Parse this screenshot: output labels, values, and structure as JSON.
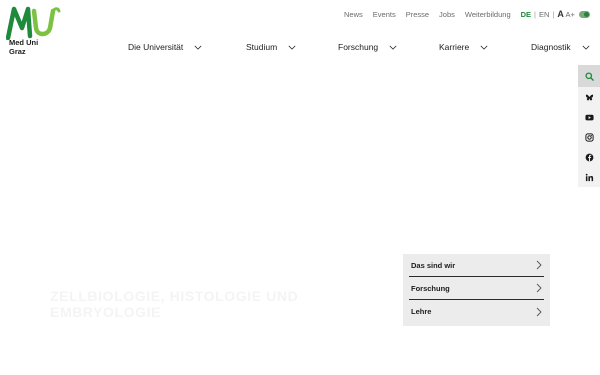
{
  "brand": {
    "logo_text_line1": "Med Uni",
    "logo_text_line2": "Graz",
    "green": "#1e8a3c",
    "light_green": "#7cc242"
  },
  "meta_nav": {
    "links": [
      "News",
      "Events",
      "Presse",
      "Jobs",
      "Weiterbildung"
    ],
    "lang_active": "DE",
    "lang_sep": "|",
    "lang_other": "EN",
    "fontsize_sep": "|",
    "fontsize_small": "A",
    "fontsize_big": "A+"
  },
  "main_nav": {
    "items": [
      "Die Universität",
      "Studium",
      "Forschung",
      "Karriere",
      "Diagnostik"
    ]
  },
  "social": {
    "icons": [
      "search-icon",
      "bluesky-icon",
      "youtube-icon",
      "instagram-icon",
      "facebook-icon",
      "linkedin-icon"
    ]
  },
  "hero": {
    "title": "Zellbiologie, Histologie und Embryologie"
  },
  "quick_links": {
    "items": [
      "Das sind wir",
      "Forschung",
      "Lehre"
    ]
  }
}
